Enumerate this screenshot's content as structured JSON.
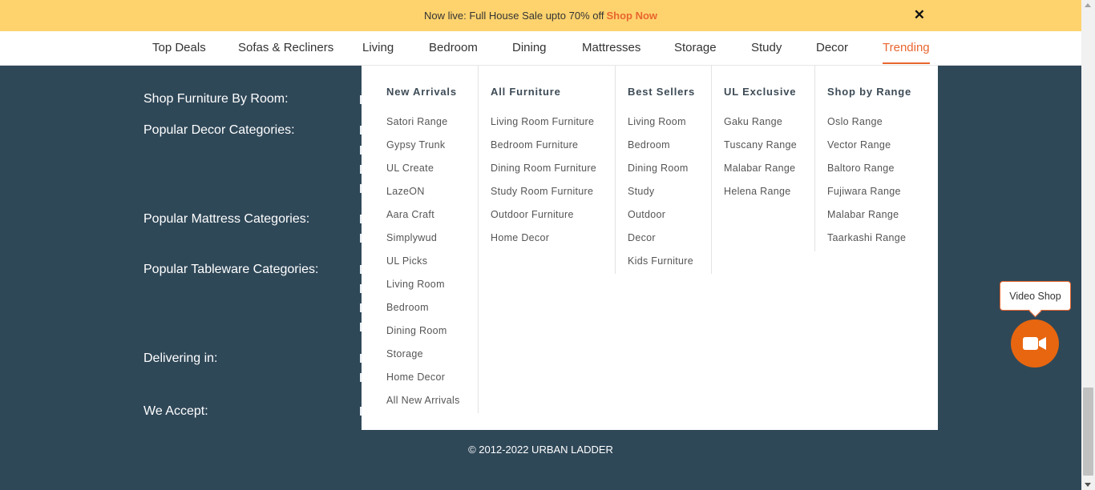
{
  "banner": {
    "text": "Now live: Full House Sale upto 70% off",
    "cta": "Shop Now",
    "close": "✕"
  },
  "nav": [
    "Top Deals",
    "Sofas & Recliners",
    "Living",
    "Bedroom",
    "Dining",
    "Mattresses",
    "Storage",
    "Study",
    "Decor",
    "Trending"
  ],
  "footer": {
    "labels": [
      "Shop Furniture By Room:",
      "Popular Decor Categories:",
      "Popular Mattress Categories:",
      "Popular Tableware Categories:",
      "Delivering in:",
      "We Accept:"
    ],
    "copyright": "© 2012-2022 URBAN LADDER"
  },
  "megamenu": [
    {
      "heading": "New Arrivals",
      "items": [
        "Satori Range",
        "Gypsy Trunk",
        "UL Create",
        "LazeON",
        "Aara Craft",
        "Simplywud",
        "UL Picks",
        "Living Room",
        "Bedroom",
        "Dining Room",
        "Storage",
        "Home Decor",
        "All New Arrivals"
      ]
    },
    {
      "heading": "All Furniture",
      "items": [
        "Living Room Furniture",
        "Bedroom Furniture",
        "Dining Room Furniture",
        "Study Room Furniture",
        "Outdoor Furniture",
        "Home Decor"
      ]
    },
    {
      "heading": "Best Sellers",
      "items": [
        "Living Room",
        "Bedroom",
        "Dining Room",
        "Study",
        "Outdoor",
        "Decor",
        "Kids Furniture"
      ]
    },
    {
      "heading": "UL Exclusive",
      "items": [
        "Gaku Range",
        "Tuscany Range",
        "Malabar Range",
        "Helena Range"
      ]
    },
    {
      "heading": "Shop by Range",
      "items": [
        "Oslo Range",
        "Vector Range",
        "Baltoro Range",
        "Fujiwara Range",
        "Malabar Range",
        "Taarkashi Range"
      ]
    }
  ],
  "video_shop": {
    "label": "Video Shop",
    "icon": "video-camera-icon"
  },
  "colors": {
    "accent": "#e8662f",
    "banner": "#fed36e",
    "footer": "#2f4858"
  }
}
